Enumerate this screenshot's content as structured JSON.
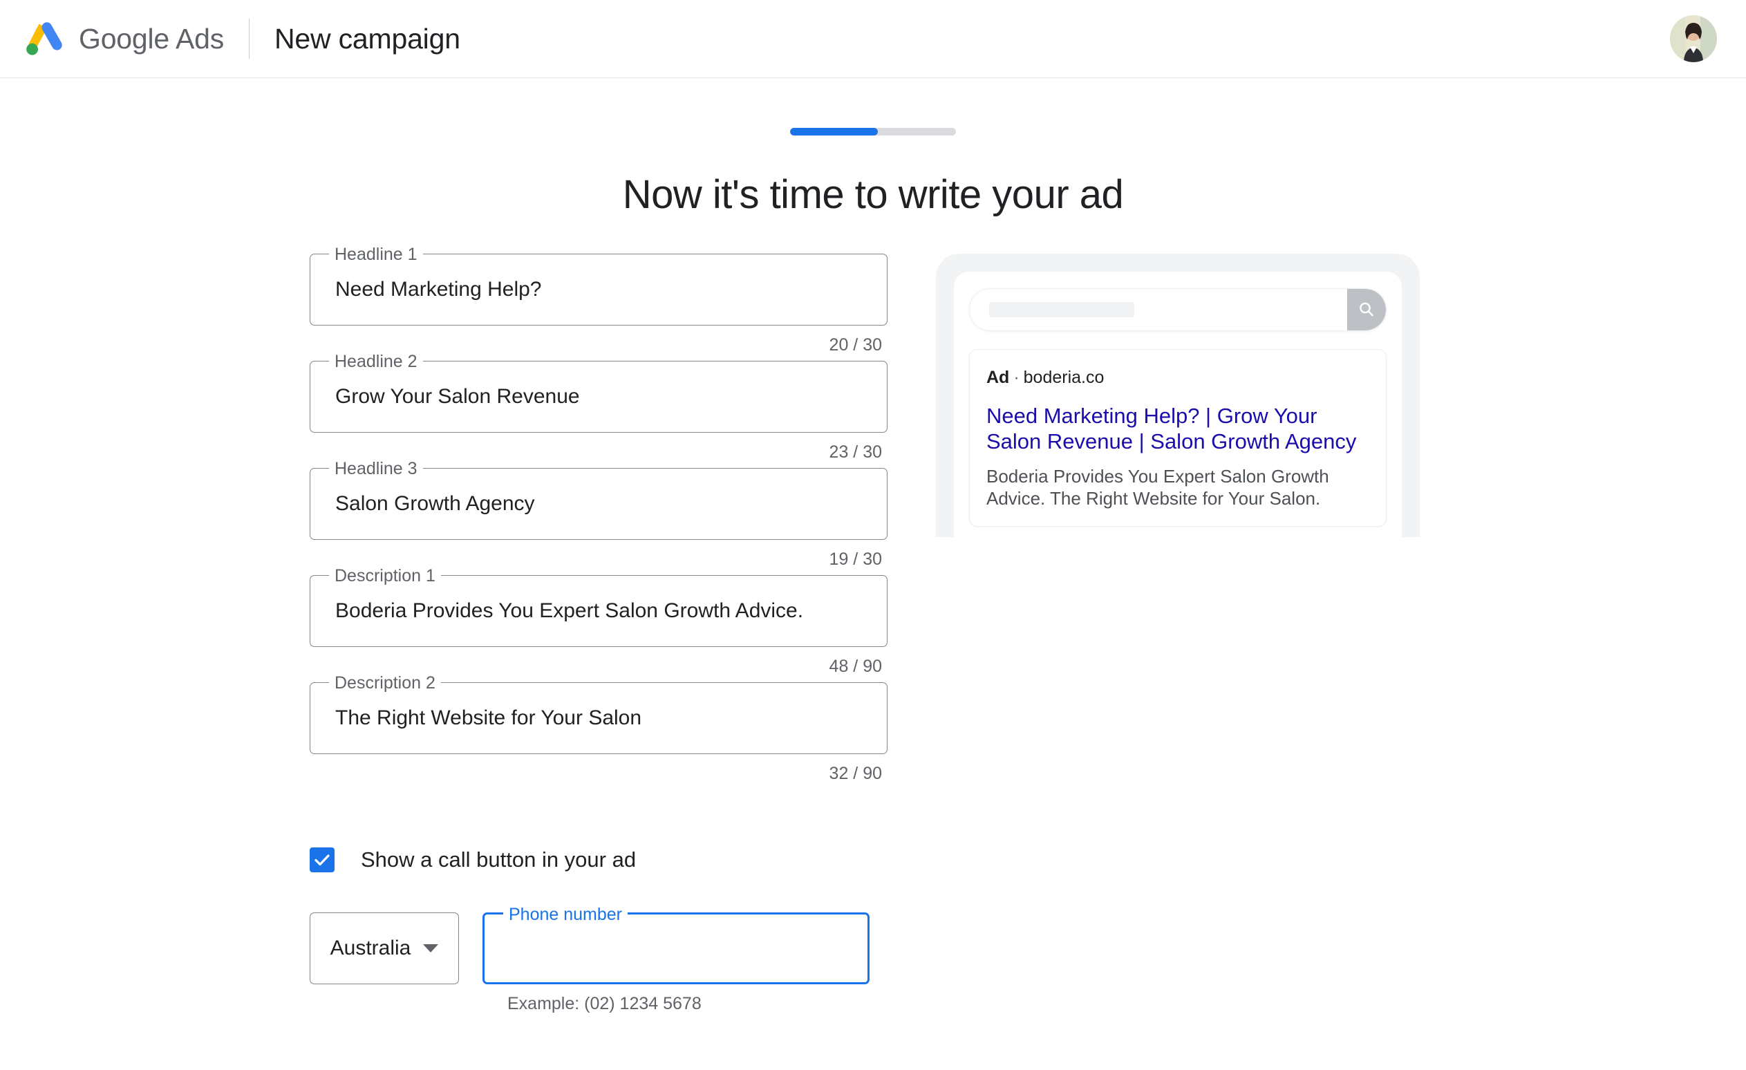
{
  "header": {
    "brand_google": "Google",
    "brand_ads": "Ads",
    "page_title": "New campaign",
    "avatar_alt": "user-avatar"
  },
  "progress": {
    "percent": "53"
  },
  "heading": "Now it's time to write your ad",
  "fields": [
    {
      "label": "Headline 1",
      "value": "Need Marketing Help?",
      "counter": "20 / 30"
    },
    {
      "label": "Headline 2",
      "value": "Grow Your Salon Revenue",
      "counter": "23 / 30"
    },
    {
      "label": "Headline 3",
      "value": "Salon Growth Agency",
      "counter": "19 / 30"
    },
    {
      "label": "Description 1",
      "value": "Boderia Provides You Expert Salon Growth Advice.",
      "counter": "48 / 90"
    },
    {
      "label": "Description 2",
      "value": "The Right Website for Your Salon",
      "counter": "32 / 90"
    }
  ],
  "call_option": {
    "checkbox_label": "Show a call button in your ad",
    "checked": "true"
  },
  "phone": {
    "country": "Australia",
    "phone_label": "Phone number",
    "phone_value": "",
    "hint": "Example: (02) 1234 5678"
  },
  "preview": {
    "search_placeholder": "",
    "ad_badge": "Ad",
    "separator": "·",
    "domain": "boderia.co",
    "ad_title": "Need Marketing Help? | Grow Your Salon Revenue | Salon Growth Agency",
    "ad_description": "Boderia Provides You Expert Salon Growth Advice. The Right Website for Your Salon."
  },
  "colors": {
    "accent_blue": "#1a73e8",
    "link_blue": "#1a0dab",
    "text_primary": "#202124",
    "text_secondary": "#5f6368",
    "border_grey": "#80868b"
  }
}
